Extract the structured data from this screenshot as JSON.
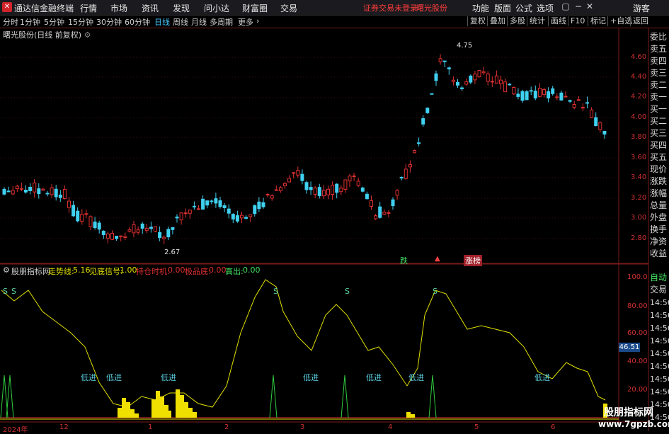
{
  "titlebar": {
    "app_name": "通达信金融终端",
    "menus": [
      "行情",
      "市场",
      "资讯",
      "发现",
      "问小达",
      "财富圈",
      "交易"
    ],
    "status": "证券交易未登录",
    "stock_name": "曙光股份",
    "right_menus": [
      "功能",
      "版面",
      "公式",
      "选项"
    ],
    "guest": "游客"
  },
  "periodbar": {
    "periods": [
      "分时",
      "1分钟",
      "5分钟",
      "15分钟",
      "30分钟",
      "60分钟",
      "日线",
      "周线",
      "月线",
      "多周期",
      "更多"
    ],
    "active": "日线",
    "tools": [
      "复权",
      "叠加",
      "多股",
      "统计",
      "画线",
      "F10",
      "标记",
      "+自选",
      "返回"
    ]
  },
  "chart": {
    "stock_title": "曙光股份(日线 前复权)",
    "yticks": [
      "4.60",
      "4.40",
      "4.20",
      "4.00",
      "3.80",
      "3.60",
      "3.40",
      "3.20",
      "3.00",
      "2.80"
    ],
    "high_label": "4.75",
    "low_label": "2.67",
    "marks": [
      "跌",
      "涨榜"
    ],
    "up_color": "#e03030",
    "down_color": "#40d0f0"
  },
  "right_panel": {
    "top_items": [
      "委比",
      "卖五",
      "卖四",
      "卖三",
      "卖二",
      "卖一",
      "买一",
      "买二",
      "买三",
      "买四",
      "买五",
      "现价",
      "涨跌",
      "涨幅",
      "总量",
      "外盘",
      "换手",
      "净资",
      "收益"
    ],
    "bottom_items": [
      "自动",
      "交易"
    ],
    "times": [
      "14:56",
      "14:56",
      "14:56",
      "14:56",
      "14:56",
      "14:56",
      "14:56",
      "14:56",
      "14:56",
      "14:56"
    ]
  },
  "indicator": {
    "name": "股朋指标网",
    "trend_label": "走势线:",
    "trend_value": "5.16",
    "bottom_label": "见底信号:",
    "bottom_value": "1.00",
    "hold_label": "持仓时机:",
    "hold_value": "0.00",
    "extreme_label": "极品底:",
    "extreme_value": "0.00",
    "high_label": "高出:",
    "high_value": "0.00",
    "yticks": [
      "100.0",
      "80.00",
      "60.00",
      "40.00",
      "20.00"
    ],
    "current_value": "46.51",
    "low_in_label": "低进",
    "sell_label": "S"
  },
  "xaxis": [
    "2024年",
    "12",
    "1",
    "2",
    "3",
    "4",
    "5",
    "6"
  ],
  "watermark": {
    "line1": "股朋指标网",
    "line2": "www.7gpzb.com"
  }
}
